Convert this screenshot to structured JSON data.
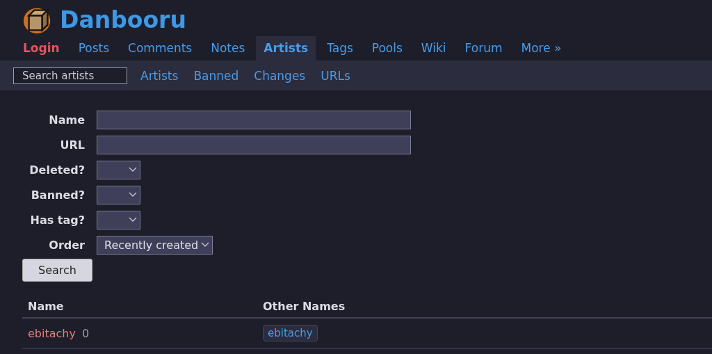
{
  "site": {
    "title": "Danbooru"
  },
  "nav": [
    {
      "label": "Login",
      "kind": "login",
      "selected": false
    },
    {
      "label": "Posts",
      "kind": "link",
      "selected": false
    },
    {
      "label": "Comments",
      "kind": "link",
      "selected": false
    },
    {
      "label": "Notes",
      "kind": "link",
      "selected": false
    },
    {
      "label": "Artists",
      "kind": "link",
      "selected": true
    },
    {
      "label": "Tags",
      "kind": "link",
      "selected": false
    },
    {
      "label": "Pools",
      "kind": "link",
      "selected": false
    },
    {
      "label": "Wiki",
      "kind": "link",
      "selected": false
    },
    {
      "label": "Forum",
      "kind": "link",
      "selected": false
    },
    {
      "label": "More »",
      "kind": "link",
      "selected": false
    }
  ],
  "subnav": {
    "search": {
      "placeholder": "Search artists"
    },
    "links": [
      "Artists",
      "Banned",
      "Changes",
      "URLs"
    ]
  },
  "form": {
    "fields": [
      {
        "label": "Name",
        "kind": "text"
      },
      {
        "label": "URL",
        "kind": "text"
      },
      {
        "label": "Deleted?",
        "kind": "select"
      },
      {
        "label": "Banned?",
        "kind": "select"
      },
      {
        "label": "Has tag?",
        "kind": "select"
      },
      {
        "label": "Order",
        "kind": "select",
        "value": "Recently created"
      }
    ],
    "button": "Search"
  },
  "table": {
    "columns": [
      "Name",
      "Other Names"
    ],
    "rows": [
      {
        "name": "ebitachy",
        "count": "0",
        "other_names": [
          "ebitachy"
        ]
      }
    ]
  }
}
